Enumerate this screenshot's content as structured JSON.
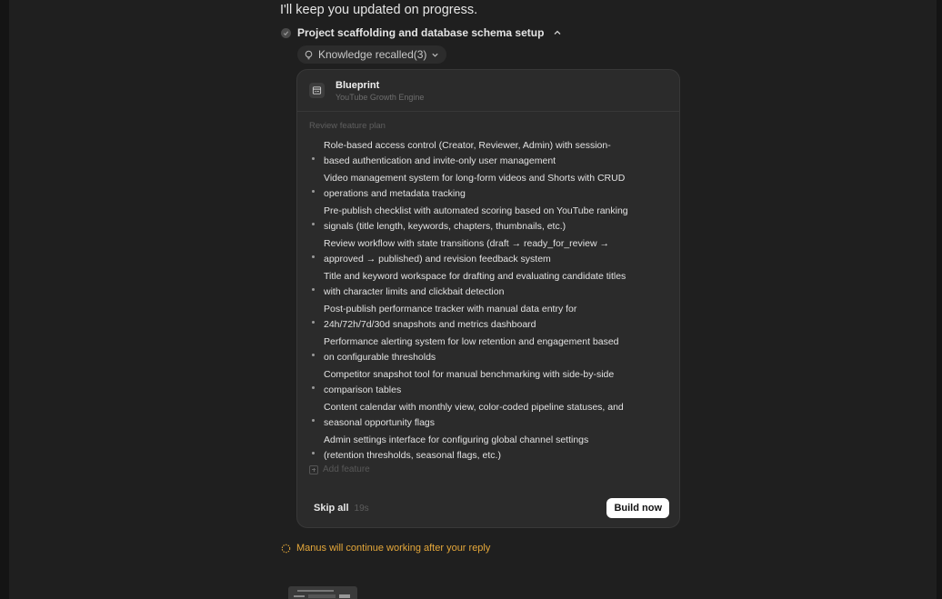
{
  "message": {
    "updated_text": "I'll keep you updated on progress."
  },
  "task": {
    "title": "Project scaffolding and database schema setup"
  },
  "knowledge": {
    "label": "Knowledge recalled(3)"
  },
  "card": {
    "title": "Blueprint",
    "subtitle": "YouTube Growth Engine",
    "section_label": "Review feature plan",
    "features": [
      {
        "text": "Role-based access control (Creator, Reviewer, Admin) with session-based authentication and invite-only user management"
      },
      {
        "text": "Video management system for long-form videos and Shorts with CRUD operations and metadata tracking"
      },
      {
        "text": "Pre-publish checklist with automated scoring based on YouTube ranking signals (title length, keywords, chapters, thumbnails, etc.)"
      },
      {
        "text": "Review workflow with state transitions (draft → ready_for_review → approved → published) and revision feedback system"
      },
      {
        "text": "Title and keyword workspace for drafting and evaluating candidate titles with character limits and clickbait detection"
      },
      {
        "text": "Post-publish performance tracker with manual data entry for 24h/72h/7d/30d snapshots and metrics dashboard"
      },
      {
        "text": "Performance alerting system for low retention and engagement based on configurable thresholds"
      },
      {
        "text": "Competitor snapshot tool for manual benchmarking with side-by-side comparison tables"
      },
      {
        "text": "Content calendar with monthly view, color-coded pipeline statuses, and seasonal opportunity flags"
      },
      {
        "text": "Admin settings interface for configuring global channel settings (retention thresholds, seasonal flags, etc.)"
      }
    ],
    "add_feature_label": "Add feature",
    "skip_label": "Skip all",
    "skip_timer": "19s",
    "build_label": "Build now"
  },
  "status": {
    "manus_text": "Manus will continue working after your reply"
  },
  "colors": {
    "background": "#1f1f1f",
    "card": "#2b2b2b",
    "accent_orange": "#e4a73a",
    "build_button": "#ffffff"
  },
  "icons": {
    "task_status": "check-circle-icon",
    "task_toggle": "chevron-up-icon",
    "knowledge": "lightbulb-icon",
    "knowledge_toggle": "chevron-down-icon",
    "blueprint": "blueprint-icon",
    "add_feature": "plus-square-icon",
    "working": "spinner-icon"
  }
}
